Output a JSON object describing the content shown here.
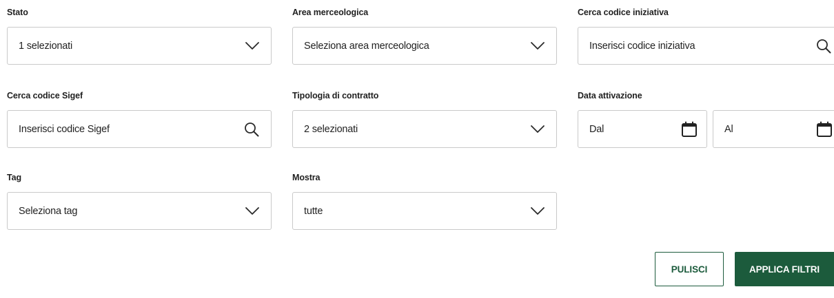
{
  "filters": {
    "stato": {
      "label": "Stato",
      "value": "1 selezionati"
    },
    "area": {
      "label": "Area merceologica",
      "value": "Seleziona area merceologica"
    },
    "codice_iniziativa": {
      "label": "Cerca codice iniziativa",
      "placeholder": "Inserisci codice iniziativa"
    },
    "codice_sigef": {
      "label": "Cerca codice Sigef",
      "placeholder": "Inserisci codice Sigef"
    },
    "tipologia": {
      "label": "Tipologia di contratto",
      "value": "2 selezionati"
    },
    "data_attivazione": {
      "label": "Data attivazione",
      "from_placeholder": "Dal",
      "to_placeholder": "Al"
    },
    "tag": {
      "label": "Tag",
      "value": "Seleziona tag"
    },
    "mostra": {
      "label": "Mostra",
      "value": "tutte"
    }
  },
  "actions": {
    "clear_label": "PULISCI",
    "apply_label": "APPLICA FILTRI"
  },
  "icons": {
    "dropdown": "chevron-down-icon",
    "search": "search-icon",
    "calendar": "calendar-icon"
  },
  "colors": {
    "primary": "#1c5b3c",
    "border": "#c9c9c9",
    "text": "#222222"
  }
}
